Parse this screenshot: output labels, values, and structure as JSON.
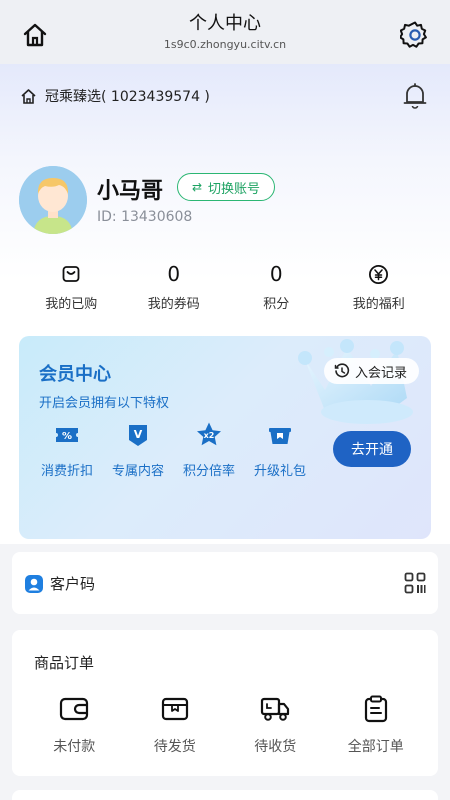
{
  "header": {
    "title": "个人中心",
    "url": "1s9c0.zhongyu.citv.cn",
    "home_icon": "home-icon",
    "settings_icon": "gear-icon"
  },
  "store": {
    "name": "冠乘臻选( 1023439574 )",
    "icon": "home-outline-icon",
    "notification_icon": "bell-icon"
  },
  "profile": {
    "name": "小马哥",
    "id_text": "ID: 13430608",
    "switch_label": "切换账号"
  },
  "stats": [
    {
      "value": "",
      "icon": "wallet-bag-icon",
      "label": "我的已购"
    },
    {
      "value": "0",
      "label": "我的券码"
    },
    {
      "value": "0",
      "label": "积分"
    },
    {
      "value": "",
      "icon": "yen-coin-icon",
      "label": "我的福利"
    }
  ],
  "vip": {
    "title": "会员中心",
    "subtitle": "开启会员拥有以下特权",
    "record_label": "入会记录",
    "open_label": "去开通",
    "perks": [
      {
        "label": "消费折扣",
        "icon_text": "%"
      },
      {
        "label": "专属内容",
        "icon_text": "V"
      },
      {
        "label": "积分倍率",
        "icon_text": "x2"
      },
      {
        "label": "升级礼包",
        "icon_text": ""
      }
    ],
    "accent": "#1a6fc6",
    "button_color": "#1f63c4"
  },
  "customer_code": {
    "label": "客户码"
  },
  "orders": {
    "title": "商品订单",
    "items": [
      {
        "label": "未付款",
        "icon": "wallet-icon"
      },
      {
        "label": "待发货",
        "icon": "package-box-icon"
      },
      {
        "label": "待收货",
        "icon": "truck-icon"
      },
      {
        "label": "全部订单",
        "icon": "clipboard-icon"
      }
    ]
  },
  "colors": {
    "switch_green": "#2bb673"
  }
}
